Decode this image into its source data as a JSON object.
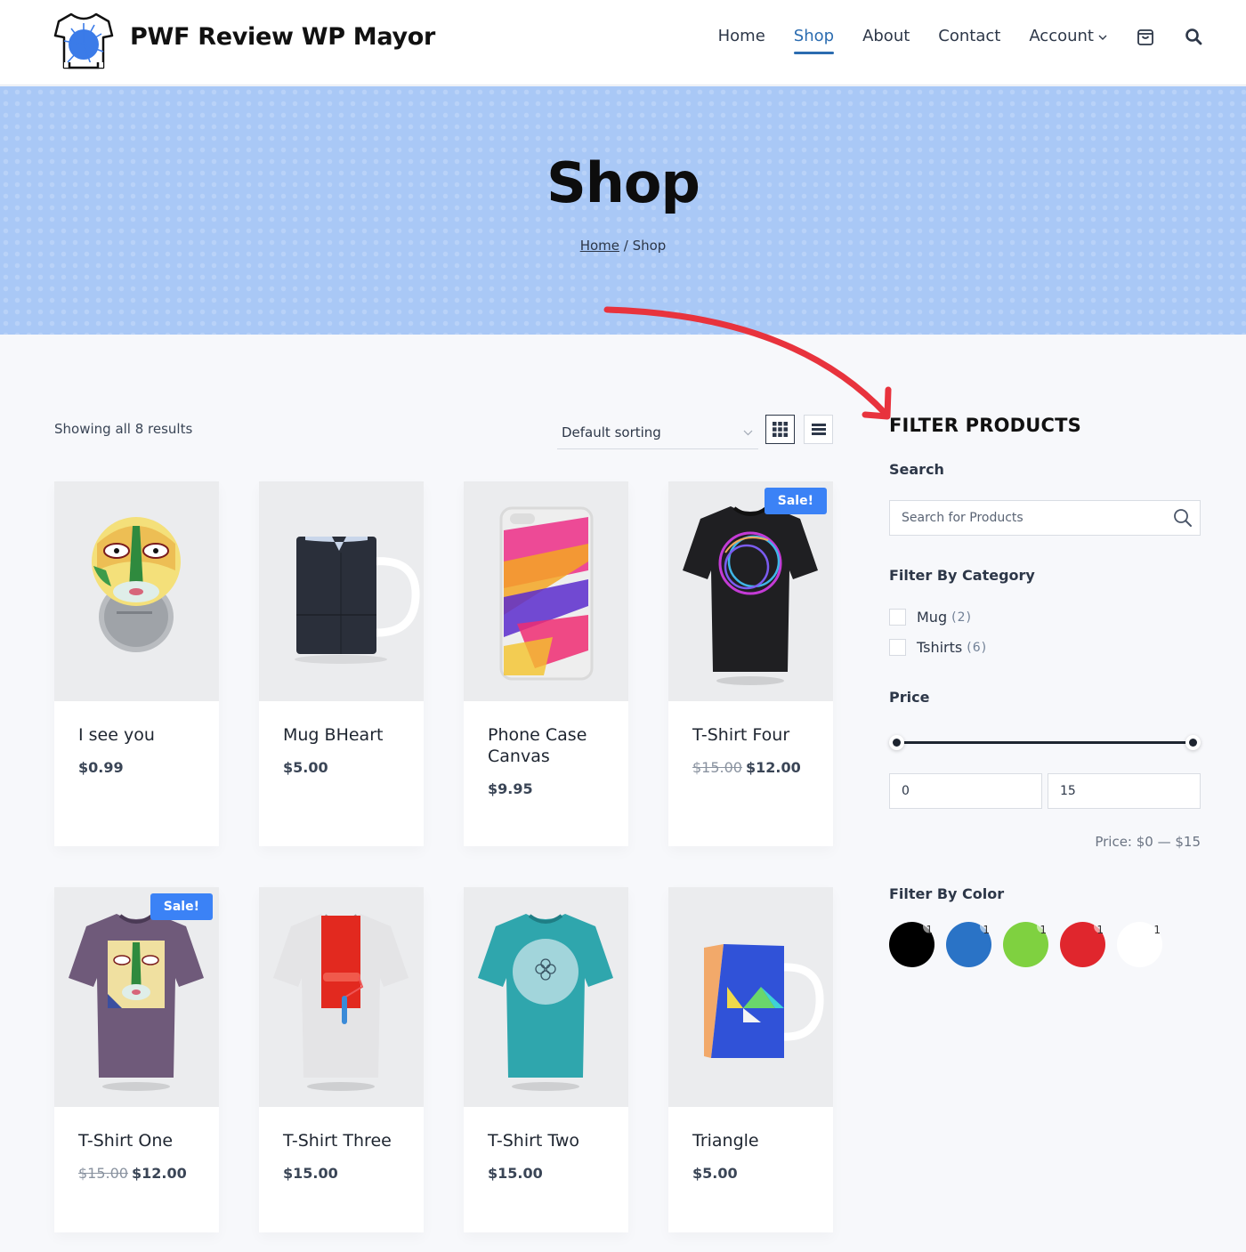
{
  "header": {
    "site_title": "PWF Review WP Mayor",
    "nav": [
      {
        "label": "Home",
        "active": false
      },
      {
        "label": "Shop",
        "active": true
      },
      {
        "label": "About",
        "active": false
      },
      {
        "label": "Contact",
        "active": false
      },
      {
        "label": "Account",
        "active": false,
        "has_dropdown": true
      }
    ],
    "icons": [
      "cart-icon",
      "search-icon"
    ]
  },
  "hero": {
    "title": "Shop",
    "breadcrumb": {
      "home": "Home",
      "separator": " / ",
      "current": "Shop"
    }
  },
  "toolbar": {
    "result_count": "Showing all 8 results",
    "sort_selected": "Default sorting",
    "view_modes": [
      "grid",
      "list"
    ],
    "active_view": "grid"
  },
  "products": [
    {
      "name": "I see you",
      "price": "$0.99",
      "old_price": null,
      "sale": false
    },
    {
      "name": "Mug BHeart",
      "price": "$5.00",
      "old_price": null,
      "sale": false
    },
    {
      "name": "Phone Case Canvas",
      "price": "$9.95",
      "old_price": null,
      "sale": false
    },
    {
      "name": "T-Shirt Four",
      "price": "$12.00",
      "old_price": "$15.00",
      "sale": true
    },
    {
      "name": "T-Shirt One",
      "price": "$12.00",
      "old_price": "$15.00",
      "sale": true
    },
    {
      "name": "T-Shirt Three",
      "price": "$15.00",
      "old_price": null,
      "sale": false
    },
    {
      "name": "T-Shirt Two",
      "price": "$15.00",
      "old_price": null,
      "sale": false
    },
    {
      "name": "Triangle",
      "price": "$5.00",
      "old_price": null,
      "sale": false
    }
  ],
  "sale_badge": "Sale!",
  "sidebar": {
    "title": "FILTER PRODUCTS",
    "search_label": "Search",
    "search_placeholder": "Search for Products",
    "category_label": "Filter By Category",
    "categories": [
      {
        "name": "Mug",
        "count": "(2)"
      },
      {
        "name": "Tshirts",
        "count": "(6)"
      }
    ],
    "price_label": "Price",
    "price_min": "0",
    "price_max": "15",
    "price_range_text": "Price: $0 — $15",
    "color_label": "Filter By Color",
    "colors": [
      {
        "name": "black",
        "hex": "#000000",
        "count": "1"
      },
      {
        "name": "blue",
        "hex": "#2a73c6",
        "count": "1"
      },
      {
        "name": "green",
        "hex": "#7fd140",
        "count": "1"
      },
      {
        "name": "red",
        "hex": "#e0262d",
        "count": "1"
      },
      {
        "name": "white",
        "hex": "#ffffff",
        "count": "1"
      }
    ]
  },
  "colors": {
    "accent": "#2b6cb0",
    "sale_badge": "#3b82f6",
    "hero_bg": "#a9c8f6",
    "annotation_arrow": "#e8333d"
  }
}
